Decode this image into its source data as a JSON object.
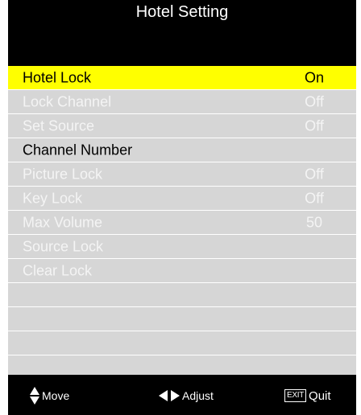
{
  "header": {
    "title": "Hotel Setting"
  },
  "colors": {
    "selected_bg": "#ffff00",
    "menu_bg": "#d6d6d6",
    "frame_bg": "#000000"
  },
  "menu": {
    "items": [
      {
        "label": "Hotel Lock",
        "value": "On"
      },
      {
        "label": "Lock Channel",
        "value": "Off"
      },
      {
        "label": "Set Source",
        "value": "Off"
      },
      {
        "label": "Channel Number",
        "value": ""
      },
      {
        "label": "Picture Lock",
        "value": "Off"
      },
      {
        "label": "Key Lock",
        "value": "Off"
      },
      {
        "label": "Max Volume",
        "value": "50"
      },
      {
        "label": "Source Lock",
        "value": ""
      },
      {
        "label": "Clear Lock",
        "value": ""
      }
    ],
    "selected_index": 0
  },
  "footer": {
    "move_label": "Move",
    "adjust_label": "Adjust",
    "exit_key_label": "EXIT",
    "quit_label": "Quit",
    "icons": [
      "up-down-arrow-icon",
      "left-arrow-icon",
      "right-arrow-icon",
      "exit-key-icon"
    ]
  }
}
